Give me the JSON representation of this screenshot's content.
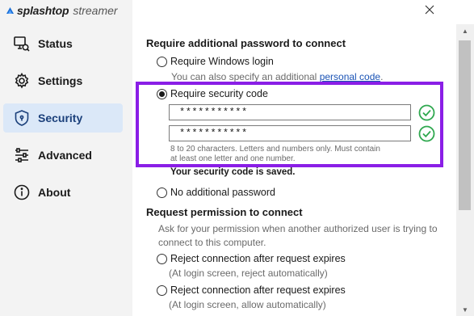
{
  "app": {
    "brand": "splashtop",
    "product": "streamer",
    "close_label": "×"
  },
  "sidebar": {
    "items": [
      {
        "label": "Status",
        "icon": "status-icon",
        "active": false
      },
      {
        "label": "Settings",
        "icon": "gear-icon",
        "active": false
      },
      {
        "label": "Security",
        "icon": "shield-icon",
        "active": true
      },
      {
        "label": "Advanced",
        "icon": "sliders-icon",
        "active": false
      },
      {
        "label": "About",
        "icon": "info-icon",
        "active": false
      }
    ]
  },
  "security": {
    "title": "Require additional password to connect",
    "options": {
      "windows_login": {
        "label": "Require Windows login",
        "checked": false
      },
      "security_code": {
        "label": "Require security code",
        "checked": true
      },
      "no_password": {
        "label": "No additional password",
        "checked": false
      }
    },
    "personal_hint_prefix": "You can also specify an additional ",
    "personal_hint_link": "personal code",
    "personal_hint_suffix": ".",
    "code_value": "***********",
    "confirm_value": "***********",
    "requirements_line1": "8 to 20 characters. Letters and numbers only. Must contain",
    "requirements_line2": "at least one letter and one number.",
    "saved_message": "Your security code is saved."
  },
  "permission": {
    "title": "Request permission to connect",
    "desc_line1": "Ask for your permission when another authorized user is trying to",
    "desc_line2": "connect to this computer.",
    "options": [
      {
        "label": "Reject connection after request expires",
        "sub": "(At login screen, reject automatically)",
        "checked": false
      },
      {
        "label": "Reject connection after request expires",
        "sub": "(At login screen, allow automatically)",
        "checked": false
      }
    ]
  },
  "colors": {
    "accent_highlight": "#8a1ee6",
    "check_green": "#2fa84f",
    "link": "#1a53b5",
    "active_nav_bg": "#dbe8f8"
  }
}
